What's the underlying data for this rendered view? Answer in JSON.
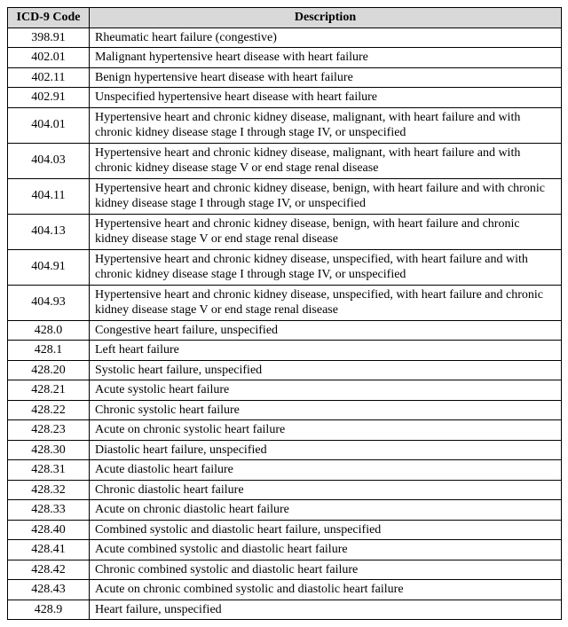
{
  "headers": {
    "code": "ICD-9 Code",
    "description": "Description"
  },
  "rows": [
    {
      "code": "398.91",
      "description": "Rheumatic heart failure (congestive)"
    },
    {
      "code": "402.01",
      "description": "Malignant hypertensive heart disease with heart failure"
    },
    {
      "code": "402.11",
      "description": "Benign hypertensive heart disease with heart failure"
    },
    {
      "code": "402.91",
      "description": "Unspecified hypertensive heart disease with heart failure"
    },
    {
      "code": "404.01",
      "description": "Hypertensive heart and chronic kidney disease, malignant, with heart failure and with chronic kidney disease stage I through stage IV, or unspecified"
    },
    {
      "code": "404.03",
      "description": "Hypertensive heart and chronic kidney disease, malignant, with heart failure and with chronic kidney disease stage V or end stage renal disease"
    },
    {
      "code": "404.11",
      "description": "Hypertensive heart and chronic kidney disease, benign, with heart failure and with chronic kidney disease stage I through stage IV, or unspecified"
    },
    {
      "code": "404.13",
      "description": "Hypertensive heart and chronic kidney disease, benign, with heart failure and chronic kidney disease stage V or end stage renal disease"
    },
    {
      "code": "404.91",
      "description": "Hypertensive heart and chronic kidney disease, unspecified, with heart failure and with chronic kidney disease stage I through stage IV, or unspecified"
    },
    {
      "code": "404.93",
      "description": "Hypertensive heart and chronic kidney disease, unspecified, with heart failure and chronic kidney disease stage V or end stage renal disease"
    },
    {
      "code": "428.0",
      "description": "Congestive heart failure, unspecified"
    },
    {
      "code": "428.1",
      "description": "Left heart failure"
    },
    {
      "code": "428.20",
      "description": "Systolic heart failure, unspecified"
    },
    {
      "code": "428.21",
      "description": "Acute systolic heart failure"
    },
    {
      "code": "428.22",
      "description": "Chronic systolic heart failure"
    },
    {
      "code": "428.23",
      "description": "Acute on chronic systolic heart failure"
    },
    {
      "code": "428.30",
      "description": "Diastolic heart failure, unspecified"
    },
    {
      "code": "428.31",
      "description": "Acute diastolic heart failure"
    },
    {
      "code": "428.32",
      "description": "Chronic diastolic heart failure"
    },
    {
      "code": "428.33",
      "description": "Acute on chronic diastolic heart failure"
    },
    {
      "code": "428.40",
      "description": "Combined systolic and diastolic heart failure, unspecified"
    },
    {
      "code": "428.41",
      "description": "Acute combined systolic and diastolic heart failure"
    },
    {
      "code": "428.42",
      "description": "Chronic combined systolic and diastolic heart failure"
    },
    {
      "code": "428.43",
      "description": "Acute on chronic combined systolic and diastolic heart failure"
    },
    {
      "code": "428.9",
      "description": "Heart failure, unspecified"
    }
  ]
}
